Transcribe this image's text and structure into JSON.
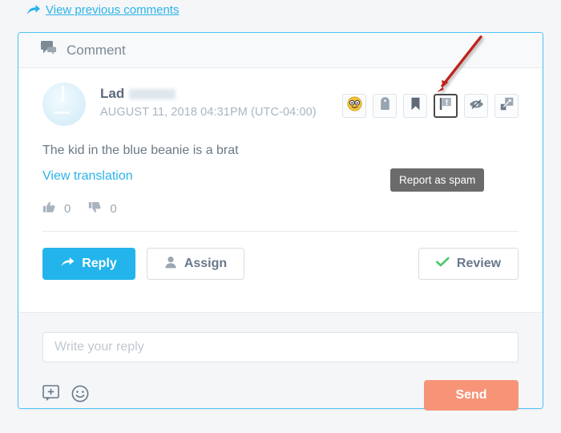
{
  "top_link": {
    "icon": "share-arrow-icon",
    "label": "View previous comments"
  },
  "card": {
    "header": {
      "icon": "comment-bubble-icon",
      "title": "Comment"
    },
    "author": {
      "avatar": "user-avatar",
      "name": "Lad",
      "name_redacted": true,
      "timestamp": "AUGUST 11, 2018 04:31PM (UTC-04:00)"
    },
    "action_icons": [
      {
        "name": "sentiment-emoji-icon",
        "glyph": "nerd-face",
        "active": false
      },
      {
        "name": "tag-icon",
        "glyph": "tag",
        "active": false
      },
      {
        "name": "bookmark-icon",
        "glyph": "bookmark",
        "active": false
      },
      {
        "name": "report-spam-flag-icon",
        "glyph": "flag-exclaim",
        "active": true
      },
      {
        "name": "hide-comment-icon",
        "glyph": "eye-slash",
        "active": false
      },
      {
        "name": "expand-icon",
        "glyph": "expand-arrow",
        "active": false
      }
    ],
    "tooltip": {
      "text": "Report as spam"
    },
    "message": {
      "body": "The kid in the blue beanie is a brat",
      "translation_link": "View translation"
    },
    "votes": {
      "up_icon": "thumbs-up-icon",
      "up_count": "0",
      "down_icon": "thumbs-down-icon",
      "down_count": "0"
    },
    "buttons": {
      "reply": "Reply",
      "assign": "Assign",
      "review": "Review"
    },
    "reply": {
      "placeholder": "Write your reply",
      "value": "",
      "canned_response_icon": "canned-response-icon",
      "emoji_icon": "emoji-picker-icon",
      "send_label": "Send"
    }
  },
  "annotation": {
    "arrow": "red-annotation-arrow",
    "color": "#c0211b"
  },
  "colors": {
    "accent_blue": "#23b4ec",
    "link_blue": "#2bb3ea",
    "card_border": "#4fc3f7",
    "send_orange": "#f79478",
    "review_green": "#4cc76a",
    "tooltip_gray": "#6b6b6b",
    "page_bg": "#f4f6f7"
  }
}
